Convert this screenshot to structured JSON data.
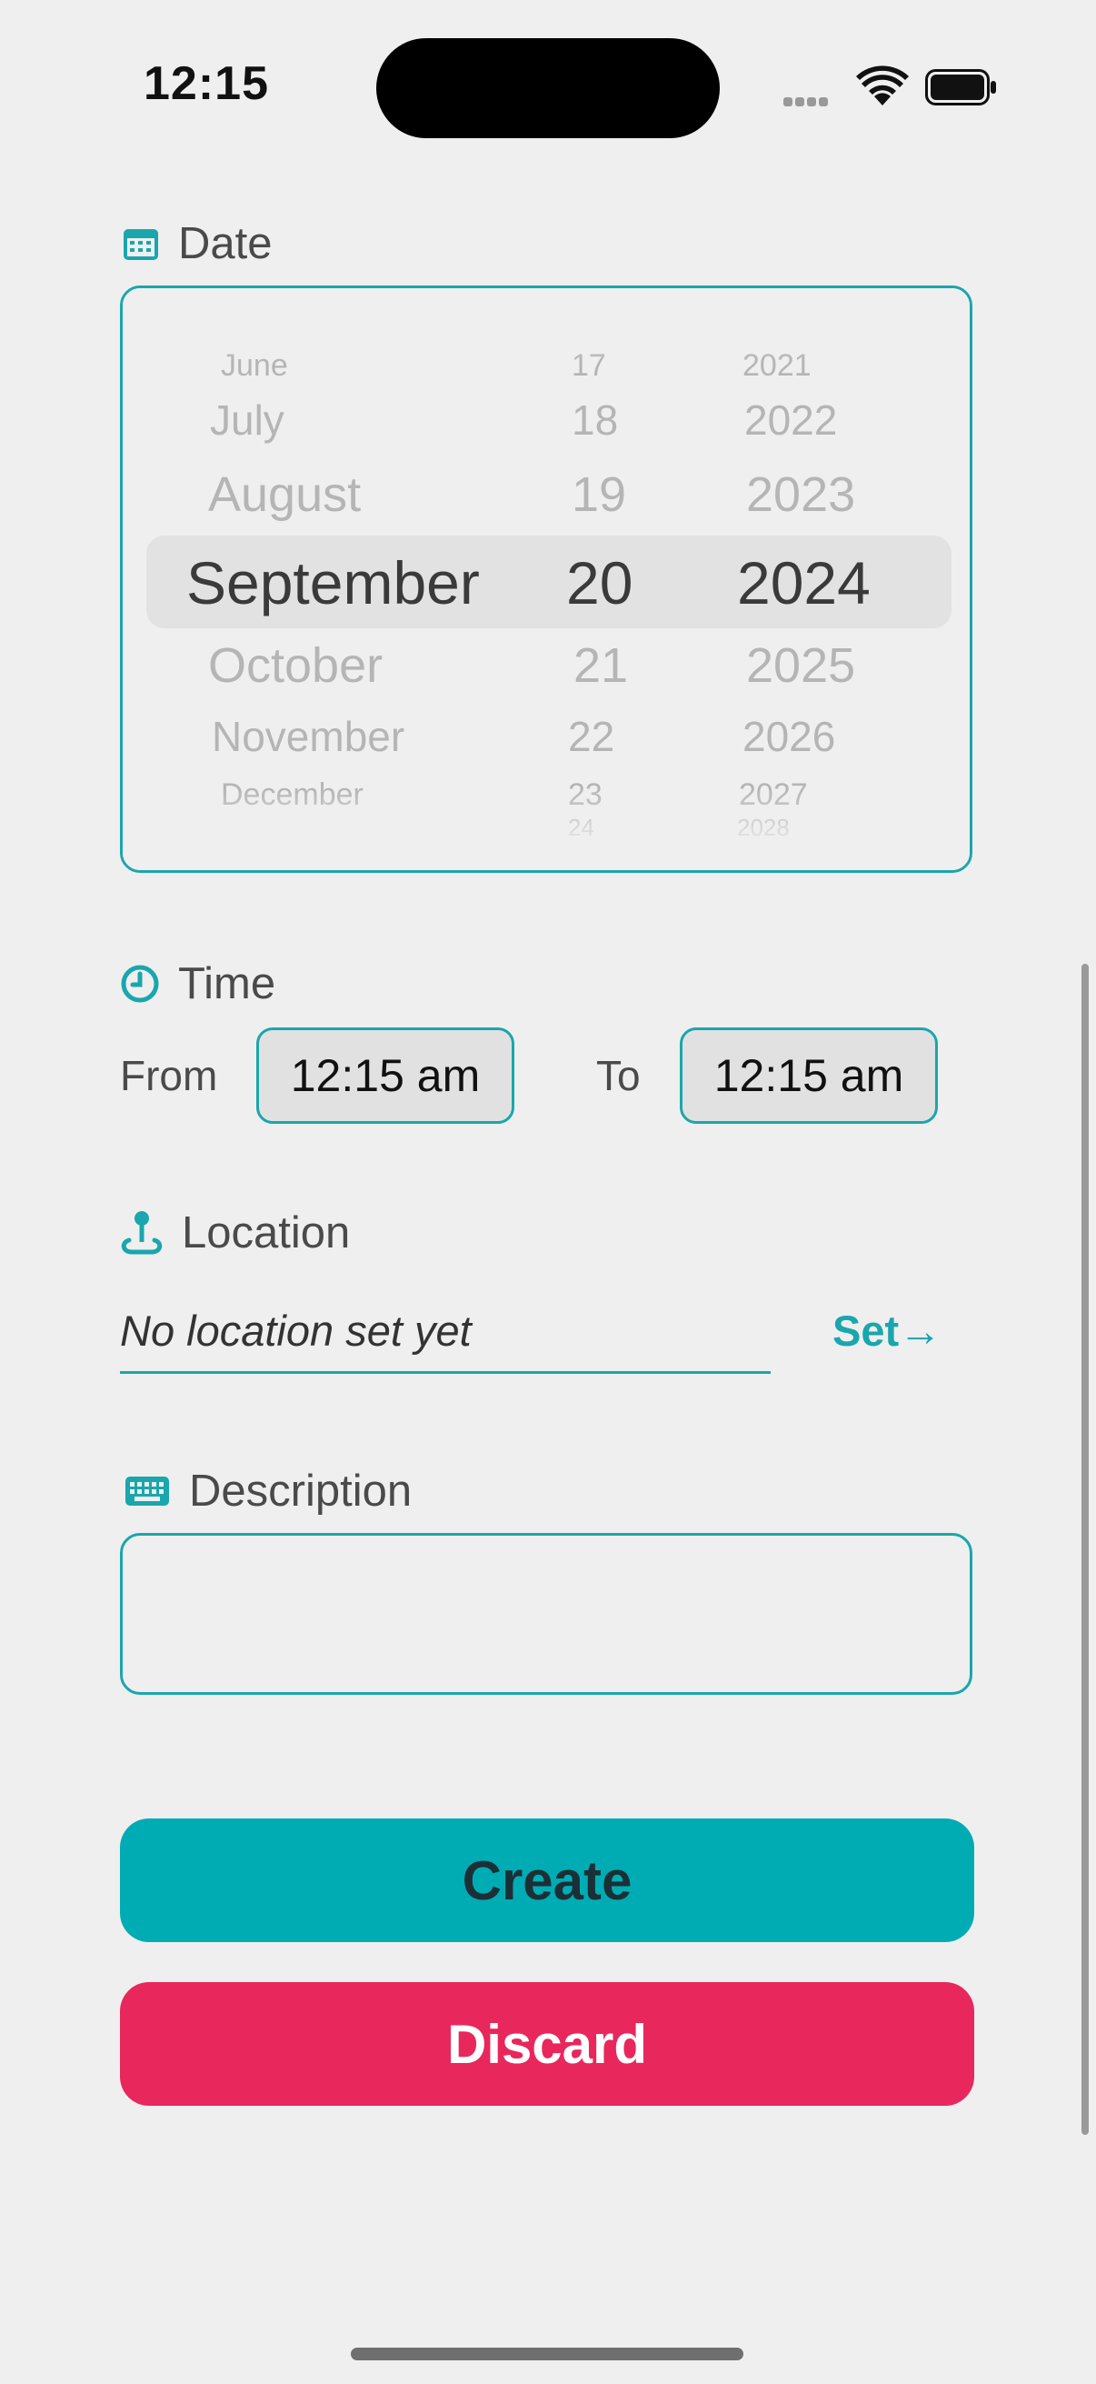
{
  "status_bar": {
    "time": "12:15"
  },
  "date": {
    "label": "Date",
    "months": [
      "June",
      "July",
      "August",
      "September",
      "October",
      "November",
      "December"
    ],
    "days": [
      "17",
      "18",
      "19",
      "20",
      "21",
      "22",
      "23",
      "24"
    ],
    "years": [
      "2021",
      "2022",
      "2023",
      "2024",
      "2025",
      "2026",
      "2027",
      "2028"
    ],
    "selected_month": "September",
    "selected_day": "20",
    "selected_year": "2024"
  },
  "time": {
    "label": "Time",
    "from_label": "From",
    "from_value": "12:15 am",
    "to_label": "To",
    "to_value": "12:15 am"
  },
  "location": {
    "label": "Location",
    "value": "No location set yet",
    "set_label": "Set→"
  },
  "description": {
    "label": "Description",
    "value": ""
  },
  "actions": {
    "create_label": "Create",
    "discard_label": "Discard"
  },
  "colors": {
    "accent": "#1aa6ad",
    "create": "#00acb4",
    "discard": "#e8275c",
    "background": "#efefef"
  }
}
